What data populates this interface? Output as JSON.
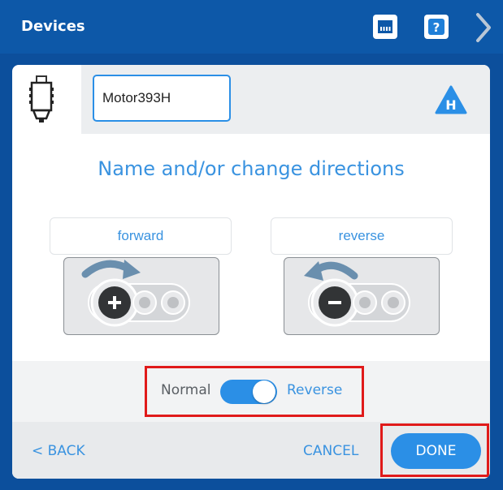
{
  "header": {
    "title": "Devices",
    "icons": [
      "port-icon",
      "help-icon",
      "next-chevron-icon"
    ]
  },
  "device": {
    "name_value": "Motor393H",
    "icon": "motor-icon",
    "badge_letter": "H"
  },
  "section": {
    "heading": "Name and/or change directions"
  },
  "directions": [
    {
      "label": "forward",
      "icon": "plus-rotate-clockwise-icon"
    },
    {
      "label": "reverse",
      "icon": "minus-rotate-counterclockwise-icon"
    }
  ],
  "toggle": {
    "left_label": "Normal",
    "right_label": "Reverse",
    "state": "Reverse"
  },
  "footer": {
    "back_label": "< BACK",
    "cancel_label": "CANCEL",
    "done_label": "DONE"
  },
  "colors": {
    "topbar": "#0d58a8",
    "accent": "#2b8fe6",
    "highlight": "#e01a1a"
  }
}
